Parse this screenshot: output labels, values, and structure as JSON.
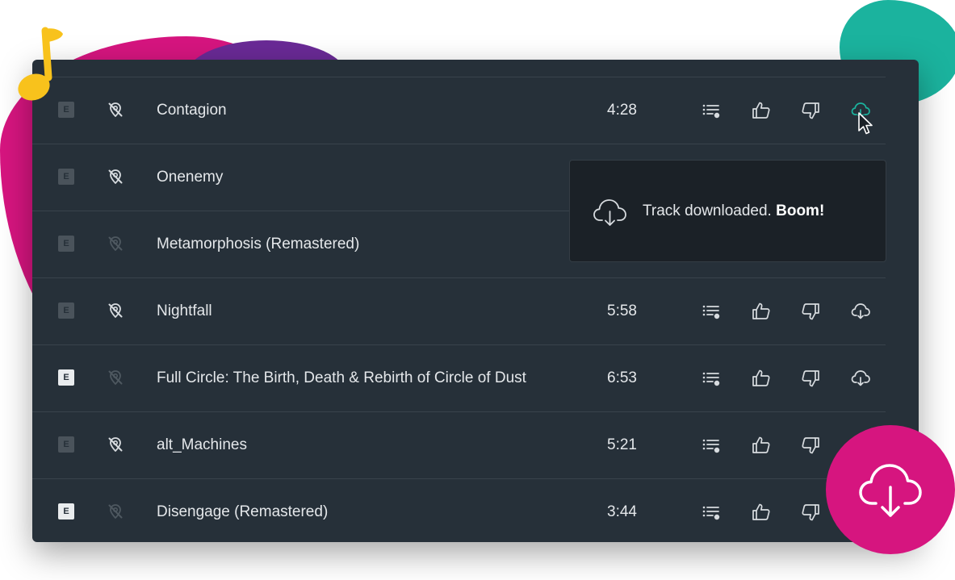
{
  "colors": {
    "panel_bg": "#263039",
    "toast_bg": "#1b2127",
    "accent_pink": "#d6157f",
    "accent_teal": "#1bb39e",
    "accent_purple": "#6a2a96",
    "note_yellow": "#f8c21c",
    "text": "#e4e7ea",
    "icon": "#d7dbdf",
    "icon_dim": "#4e5860"
  },
  "explicit_badge_label": "E",
  "icons": {
    "no_location": "location-off-icon",
    "queue": "add-to-queue-icon",
    "thumb_up": "thumbs-up-icon",
    "thumb_down": "thumbs-down-icon",
    "download": "cloud-download-icon",
    "music_note": "music-note-icon",
    "cursor": "mouse-pointer-icon"
  },
  "tracks": [
    {
      "title": "Contagion",
      "duration": "4:28",
      "explicit": false,
      "location_active": true,
      "download_state": "downloaded"
    },
    {
      "title": "Onenemy",
      "duration": "",
      "explicit": false,
      "location_active": true,
      "download_state": "hidden"
    },
    {
      "title": "Metamorphosis (Remastered)",
      "duration": "",
      "explicit": false,
      "location_active": false,
      "download_state": "hidden"
    },
    {
      "title": "Nightfall",
      "duration": "5:58",
      "explicit": false,
      "location_active": true,
      "download_state": "available"
    },
    {
      "title": "Full Circle: The Birth, Death & Rebirth of Circle of Dust",
      "duration": "6:53",
      "explicit": true,
      "location_active": false,
      "download_state": "available"
    },
    {
      "title": "alt_Machines",
      "duration": "5:21",
      "explicit": false,
      "location_active": true,
      "download_state": "hidden"
    },
    {
      "title": "Disengage (Remastered)",
      "duration": "3:44",
      "explicit": true,
      "location_active": false,
      "download_state": "hidden"
    }
  ],
  "toast": {
    "message": "Track downloaded.",
    "emphasis": "Boom!"
  }
}
